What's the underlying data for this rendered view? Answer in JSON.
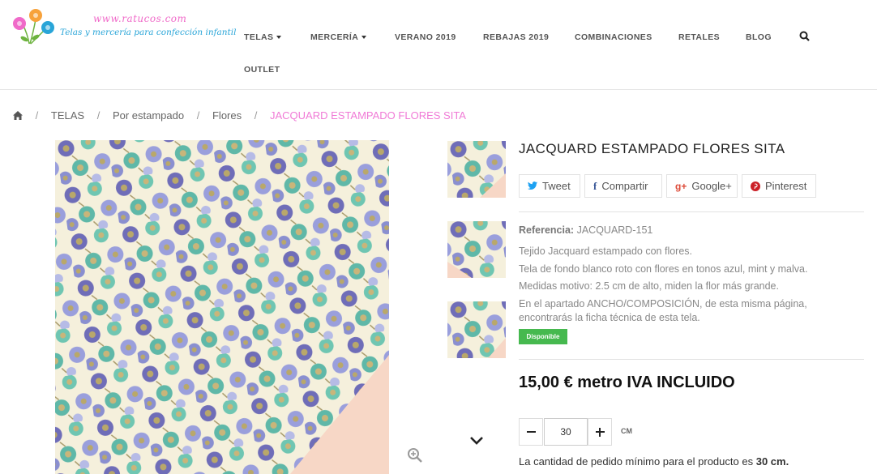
{
  "brand": {
    "url": "www.ratucos.com",
    "tagline": "Telas y mercería para confección infantil"
  },
  "nav": {
    "items": [
      {
        "label": "TELAS",
        "dropdown": true
      },
      {
        "label": "MERCERÍA",
        "dropdown": true
      },
      {
        "label": "VERANO 2019",
        "dropdown": false
      },
      {
        "label": "REBAJAS 2019",
        "dropdown": false
      },
      {
        "label": "COMBINACIONES",
        "dropdown": false
      },
      {
        "label": "RETALES",
        "dropdown": false
      },
      {
        "label": "BLOG",
        "dropdown": false
      },
      {
        "label": "OUTLET",
        "dropdown": false
      }
    ],
    "search_icon": "search-icon"
  },
  "breadcrumb": {
    "home_icon": "home-icon",
    "items": [
      "TELAS",
      "Por estampado",
      "Flores"
    ],
    "current": "JACQUARD ESTAMPADO FLORES SITA",
    "separator": "/"
  },
  "product": {
    "title": "JACQUARD ESTAMPADO FLORES SITA",
    "share": [
      {
        "icon": "twitter-icon",
        "label": "Tweet",
        "color": "#1da1f2"
      },
      {
        "icon": "facebook-icon",
        "label": "Compartir",
        "color": "#3b5998"
      },
      {
        "icon": "google-plus-icon",
        "label": "Google+",
        "color": "#dd4b39"
      },
      {
        "icon": "pinterest-icon",
        "label": "Pinterest",
        "color": "#cb2027"
      }
    ],
    "reference_label": "Referencia:",
    "reference_value": "JACQUARD-151",
    "description": [
      "Tejido Jacquard estampado con flores.",
      "Tela de fondo blanco roto con flores en tonos azul, mint y malva.",
      "Medidas motivo: 2.5 cm de alto, miden la flor más grande.",
      "En el apartado ANCHO/COMPOSICIÓN, de esta misma página,",
      "encontrarás la ficha técnica de esta tela."
    ],
    "availability": "Disponible",
    "availability_color": "#46b94f",
    "price": "15,00 € metro IVA INCLUIDO",
    "quantity": "30",
    "quantity_unit": "CM",
    "min_order_text": "La cantidad de pedido mínimo para el producto es",
    "min_order_value": "30 cm."
  },
  "colors": {
    "accent_pink": "#f07ad6",
    "brand_blue": "#29a5d8"
  }
}
